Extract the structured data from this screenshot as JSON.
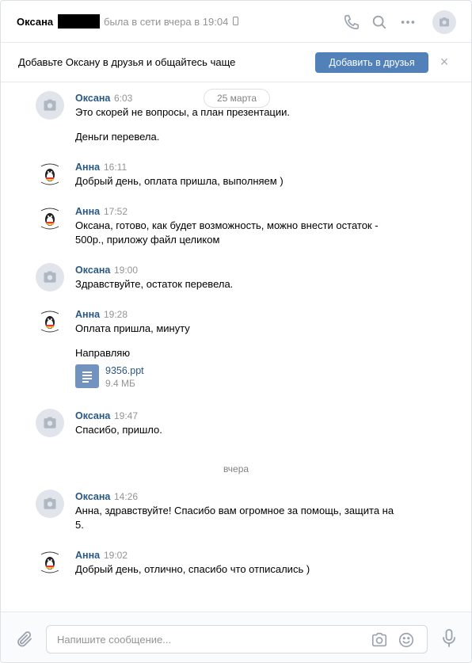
{
  "header": {
    "name": "Оксана",
    "status": "была в сети вчера в 19:04"
  },
  "banner": {
    "text": "Добавьте Оксану в друзья и общайтесь чаще",
    "button": "Добавить в друзья",
    "close": "×"
  },
  "dates": {
    "first": "25 марта",
    "second": "вчера"
  },
  "messages": [
    {
      "author": "Оксана",
      "time": "6:03",
      "lines": [
        "Это скорей не вопросы, а план презентации."
      ],
      "extra": "Деньги перевела."
    },
    {
      "author": "Анна",
      "time": "16:11",
      "lines": [
        "Добрый день, оплата пришла, выполняем )"
      ]
    },
    {
      "author": "Анна",
      "time": "17:52",
      "lines": [
        "Оксана, готово, как будет возможность, можно внести остаток -",
        "500р., приложу файл целиком"
      ]
    },
    {
      "author": "Оксана",
      "time": "19:00",
      "lines": [
        "Здравствуйте, остаток перевела."
      ]
    },
    {
      "author": "Анна",
      "time": "19:28",
      "lines": [
        "Оплата пришла, минуту"
      ],
      "extra": "Направляю",
      "file": {
        "name": "9356.ppt",
        "size": "9.4 МБ"
      }
    },
    {
      "author": "Оксана",
      "time": "19:47",
      "lines": [
        "Спасибо, пришло."
      ]
    },
    {
      "author": "Оксана",
      "time": "14:26",
      "lines": [
        "Анна, здравствуйте! Спасибо вам огромное за помощь, защита на",
        "5."
      ]
    },
    {
      "author": "Анна",
      "time": "19:02",
      "lines": [
        "Добрый день, отлично, спасибо что отписались )"
      ]
    }
  ],
  "composer": {
    "placeholder": "Напишите сообщение..."
  },
  "icons": {
    "header": [
      "phone-icon",
      "search-icon",
      "more-icon",
      "camera-icon"
    ],
    "composer": [
      "attach-icon",
      "camera-icon",
      "smile-icon",
      "microphone-icon"
    ]
  },
  "colors": {
    "accent": "#5181b8",
    "author": "#2a5885",
    "muted": "#939393"
  }
}
